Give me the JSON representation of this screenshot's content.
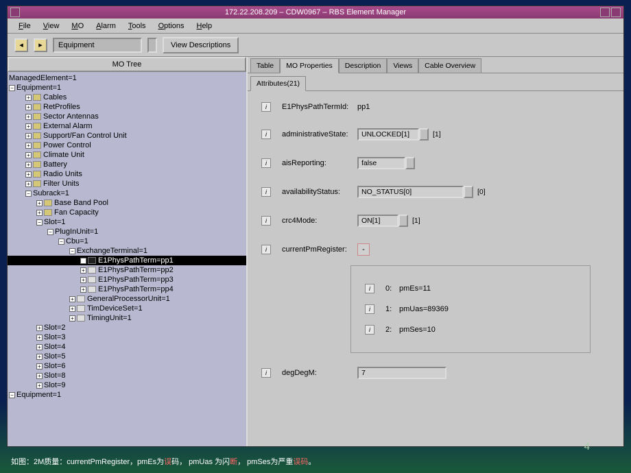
{
  "title": "172.22.208.209 – CDW0967 – RBS Element Manager",
  "menu": {
    "file": "File",
    "view": "View",
    "mo": "MO",
    "alarm": "Alarm",
    "tools": "Tools",
    "options": "Options",
    "help": "Help"
  },
  "toolbar": {
    "nav_label": "Equipment",
    "view_desc": "View Descriptions"
  },
  "tree_header": "MO Tree",
  "tree": {
    "managed": "ManagedElement=1",
    "equipment": "Equipment=1",
    "cables": "Cables",
    "ret": "RetProfiles",
    "sector": "Sector Antennas",
    "ext": "External Alarm",
    "fan": "Support/Fan Control Unit",
    "power": "Power Control",
    "climate": "Climate Unit",
    "battery": "Battery",
    "radio": "Radio Units",
    "filter": "Filter Units",
    "subrack": "Subrack=1",
    "bbp": "Base Band Pool",
    "fancap": "Fan Capacity",
    "slot1": "Slot=1",
    "plugin": "PlugInUnit=1",
    "cbu": "Cbu=1",
    "exterm": "ExchangeTerminal=1",
    "pp1": "E1PhysPathTerm=pp1",
    "pp2": "E1PhysPathTerm=pp2",
    "pp3": "E1PhysPathTerm=pp3",
    "pp4": "E1PhysPathTerm=pp4",
    "gpu": "GeneralProcessorUnit=1",
    "tim": "TimDeviceSet=1",
    "timing": "TimingUnit=1",
    "slot2": "Slot=2",
    "slot3": "Slot=3",
    "slot4": "Slot=4",
    "slot5": "Slot=5",
    "slot6": "Slot=6",
    "slot8": "Slot=8",
    "slot9": "Slot=9",
    "equipment2": "Equipment=1"
  },
  "tabs": {
    "table": "Table",
    "props": "MO Properties",
    "desc": "Description",
    "views": "Views",
    "cable": "Cable Overview",
    "attrs": "Attributes(21)"
  },
  "attrs": {
    "e1_label": "E1PhysPathTermId:",
    "e1_val": "pp1",
    "admin_label": "administrativeState:",
    "admin_val": "UNLOCKED[1]",
    "admin_suffix": "[1]",
    "ais_label": "aisReporting:",
    "ais_val": "false",
    "avail_label": "availabilityStatus:",
    "avail_val": "NO_STATUS[0]",
    "avail_suffix": "[0]",
    "crc_label": "crc4Mode:",
    "crc_val": "ON[1]",
    "crc_suffix": "[1]",
    "curpm_label": "currentPmRegister:",
    "curpm_val": "-",
    "r0_idx": "0:",
    "r0_val": "pmEs=11",
    "r1_idx": "1:",
    "r1_val": "pmUas=89369",
    "r2_idx": "2:",
    "r2_val": "pmSes=10",
    "deg_label": "degDegM:",
    "deg_val": "7"
  },
  "footer": {
    "pre": "如图：2M质量：currentPmRegister，pmEs为",
    "w1": "误",
    "w1b": "码， pmUas 为闪",
    "w2": "断",
    "w2b": "， pmSes为严重",
    "w3": "误码",
    "w3b": "。"
  },
  "page_num": "4"
}
